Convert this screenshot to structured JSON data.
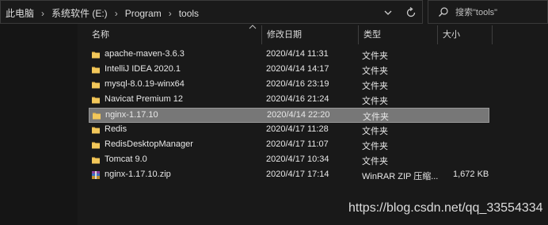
{
  "address_bar": {
    "breadcrumbs": [
      "此电脑",
      "系统软件 (E:)",
      "Program",
      "tools"
    ]
  },
  "search": {
    "placeholder": "搜索\"tools\""
  },
  "columns": {
    "name": "名称",
    "date": "修改日期",
    "type": "类型",
    "size": "大小"
  },
  "files": [
    {
      "name": "apache-maven-3.6.3",
      "date": "2020/4/14 11:31",
      "type": "文件夹",
      "size": "",
      "icon": "folder-icon",
      "selected": false
    },
    {
      "name": "IntelliJ IDEA 2020.1",
      "date": "2020/4/14 14:17",
      "type": "文件夹",
      "size": "",
      "icon": "folder-icon",
      "selected": false
    },
    {
      "name": "mysql-8.0.19-winx64",
      "date": "2020/4/16 23:19",
      "type": "文件夹",
      "size": "",
      "icon": "folder-icon",
      "selected": false
    },
    {
      "name": "Navicat Premium 12",
      "date": "2020/4/16 21:24",
      "type": "文件夹",
      "size": "",
      "icon": "folder-icon",
      "selected": false
    },
    {
      "name": "nginx-1.17.10",
      "date": "2020/4/14 22:20",
      "type": "文件夹",
      "size": "",
      "icon": "folder-icon",
      "selected": true
    },
    {
      "name": "Redis",
      "date": "2020/4/17 11:28",
      "type": "文件夹",
      "size": "",
      "icon": "folder-icon",
      "selected": false
    },
    {
      "name": "RedisDesktopManager",
      "date": "2020/4/17 11:07",
      "type": "文件夹",
      "size": "",
      "icon": "folder-icon",
      "selected": false
    },
    {
      "name": "Tomcat 9.0",
      "date": "2020/4/17 10:34",
      "type": "文件夹",
      "size": "",
      "icon": "folder-icon",
      "selected": false
    },
    {
      "name": "nginx-1.17.10.zip",
      "date": "2020/4/17 17:14",
      "type": "WinRAR ZIP 压缩...",
      "size": "1,672 KB",
      "icon": "winrar-archive-icon",
      "selected": false
    }
  ],
  "watermark": "https://blog.csdn.net/qq_33554334",
  "colors": {
    "background": "#191919",
    "selected_row": "#777777",
    "folder": "#e8b84a"
  }
}
